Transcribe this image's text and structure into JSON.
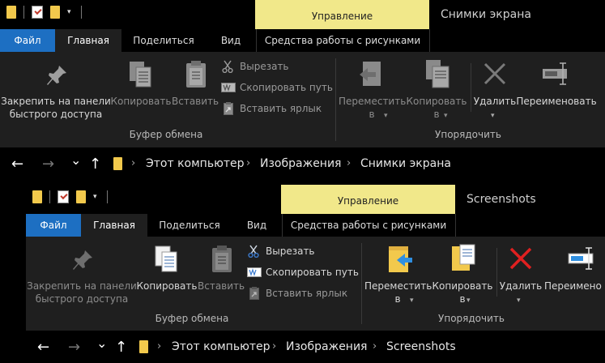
{
  "back_window": {
    "title": "Снимки экрана",
    "context_tab": "Управление",
    "tabs": {
      "file": "Файл",
      "home": "Главная",
      "share": "Поделиться",
      "view": "Вид",
      "tools": "Средства работы с рисунками"
    },
    "ribbon": {
      "pin": [
        "Закрепить на панели",
        "быстрого доступа"
      ],
      "copy": "Копировать",
      "paste": "Вставить",
      "cut": "Вырезать",
      "copy_path": "Скопировать путь",
      "paste_shortcut": "Вставить ярлык",
      "clipboard_group": "Буфер обмена",
      "move_to": [
        "Переместить",
        "в"
      ],
      "copy_to": [
        "Копировать",
        "в"
      ],
      "delete": "Удалить",
      "rename": "Переименовать",
      "organize_group": "Упорядочить"
    },
    "breadcrumbs": [
      "Этот компьютер",
      "Изображения",
      "Снимки экрана"
    ]
  },
  "front_window": {
    "title": "Screenshots",
    "context_tab": "Управление",
    "tabs": {
      "file": "Файл",
      "home": "Главная",
      "share": "Поделиться",
      "view": "Вид",
      "tools": "Средства работы с рисунками"
    },
    "ribbon": {
      "pin": [
        "Закрепить на панели",
        "быстрого доступа"
      ],
      "copy": "Копировать",
      "paste": "Вставить",
      "cut": "Вырезать",
      "copy_path": "Скопировать путь",
      "paste_shortcut": "Вставить ярлык",
      "clipboard_group": "Буфер обмена",
      "move_to": [
        "Переместить",
        "в"
      ],
      "copy_to": [
        "Копировать",
        "в"
      ],
      "delete": "Удалить",
      "rename": "Переимено",
      "organize_group": "Упорядочить"
    },
    "breadcrumbs": [
      "Этот компьютер",
      "Изображения",
      "Screenshots"
    ]
  },
  "nav_glyphs": {
    "back": "←",
    "forward": "→",
    "recent": "⌄",
    "up": "↑",
    "separator": "›",
    "dropdown": "▾"
  },
  "colors": {
    "file_tab": "#1d6fc2",
    "context_tab": "#f1e88a",
    "ribbon": "#1f1f1f",
    "folder": "#f2c94c",
    "delete_red": "#e02020"
  }
}
